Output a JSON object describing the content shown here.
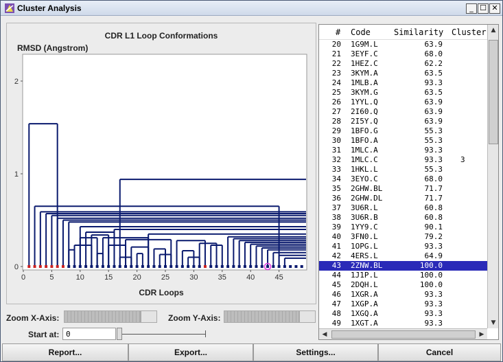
{
  "window": {
    "title": "Cluster Analysis",
    "minimize": "_",
    "maximize": "☐",
    "close": "✕"
  },
  "chart_data": {
    "type": "dendrogram",
    "title": "CDR L1 Loop Conformations",
    "xlabel": "CDR Loops",
    "ylabel": "RMSD (Angstrom)",
    "xticks": [
      "0",
      "5",
      "10",
      "15",
      "20",
      "25",
      "30",
      "35",
      "40",
      "45"
    ],
    "yticks": [
      "0",
      "1",
      "2"
    ],
    "ylim": [
      0,
      2.2
    ],
    "xlim": [
      0,
      50
    ],
    "line_color": "#0a1a6e",
    "leaf_color_default": "#0a1a6e",
    "leaf_color_highlight": "#cc2222",
    "selected_leaf": 43,
    "merges": [
      {
        "from": [
          1,
          6
        ],
        "height": 1.54
      },
      {
        "from": [
          17,
          50
        ],
        "height": 0.94
      },
      {
        "from": [
          2,
          45
        ],
        "height": 0.65
      },
      {
        "from": [
          3,
          50
        ],
        "height": 0.59
      },
      {
        "from": [
          4,
          50
        ],
        "height": 0.57
      },
      {
        "from": [
          5,
          50
        ],
        "height": 0.55
      },
      {
        "from": [
          6,
          50
        ],
        "height": 0.52
      },
      {
        "from": [
          7,
          50
        ],
        "height": 0.5
      },
      {
        "from": [
          8,
          50
        ],
        "height": 0.48
      },
      {
        "from": [
          10,
          50
        ],
        "height": 0.43
      },
      {
        "from": [
          11,
          16
        ],
        "height": 0.37
      },
      {
        "from": [
          16,
          50
        ],
        "height": 0.4
      },
      {
        "from": [
          10,
          13
        ],
        "height": 0.31
      },
      {
        "from": [
          12,
          15
        ],
        "height": 0.34
      },
      {
        "from": [
          14,
          22
        ],
        "height": 0.31
      },
      {
        "from": [
          22,
          50
        ],
        "height": 0.35
      },
      {
        "from": [
          9,
          12
        ],
        "height": 0.23
      },
      {
        "from": [
          15,
          18
        ],
        "height": 0.23
      },
      {
        "from": [
          18,
          26
        ],
        "height": 0.29
      },
      {
        "from": [
          27,
          32
        ],
        "height": 0.28
      },
      {
        "from": [
          31,
          34
        ],
        "height": 0.25
      },
      {
        "from": [
          36,
          50
        ],
        "height": 0.32
      },
      {
        "from": [
          37,
          50
        ],
        "height": 0.3
      },
      {
        "from": [
          38,
          50
        ],
        "height": 0.28
      },
      {
        "from": [
          39,
          50
        ],
        "height": 0.26
      },
      {
        "from": [
          40,
          50
        ],
        "height": 0.24
      },
      {
        "from": [
          41,
          50
        ],
        "height": 0.22
      },
      {
        "from": [
          42,
          50
        ],
        "height": 0.2
      },
      {
        "from": [
          43,
          50
        ],
        "height": 0.18
      },
      {
        "from": [
          44,
          50
        ],
        "height": 0.15
      },
      {
        "from": [
          45,
          50
        ],
        "height": 0.12
      },
      {
        "from": [
          46,
          50
        ],
        "height": 0.09
      },
      {
        "from": [
          33,
          35
        ],
        "height": 0.23
      },
      {
        "from": [
          19,
          22
        ],
        "height": 0.21
      },
      {
        "from": [
          23,
          25
        ],
        "height": 0.19
      },
      {
        "from": [
          28,
          30
        ],
        "height": 0.17
      },
      {
        "from": [
          20,
          21
        ],
        "height": 0.14
      },
      {
        "from": [
          24,
          26
        ],
        "height": 0.13
      },
      {
        "from": [
          29,
          31
        ],
        "height": 0.1
      },
      {
        "from": [
          13,
          14
        ],
        "height": 0.14
      },
      {
        "from": [
          17,
          19
        ],
        "height": 0.1
      },
      {
        "from": [
          8,
          9
        ],
        "height": 0.18
      }
    ],
    "leaves": [
      {
        "x": 1,
        "c": "r"
      },
      {
        "x": 2,
        "c": "r"
      },
      {
        "x": 3,
        "c": "r"
      },
      {
        "x": 4,
        "c": "r"
      },
      {
        "x": 5,
        "c": "r"
      },
      {
        "x": 6,
        "c": "r"
      },
      {
        "x": 7,
        "c": "r"
      },
      {
        "x": 8,
        "c": "b"
      },
      {
        "x": 9,
        "c": "b"
      },
      {
        "x": 10,
        "c": "b"
      },
      {
        "x": 11,
        "c": "b"
      },
      {
        "x": 12,
        "c": "b"
      },
      {
        "x": 13,
        "c": "b"
      },
      {
        "x": 14,
        "c": "b"
      },
      {
        "x": 15,
        "c": "b"
      },
      {
        "x": 16,
        "c": "b"
      },
      {
        "x": 17,
        "c": "b"
      },
      {
        "x": 18,
        "c": "b"
      },
      {
        "x": 19,
        "c": "b"
      },
      {
        "x": 20,
        "c": "b"
      },
      {
        "x": 21,
        "c": "b"
      },
      {
        "x": 22,
        "c": "b"
      },
      {
        "x": 23,
        "c": "b"
      },
      {
        "x": 24,
        "c": "b"
      },
      {
        "x": 25,
        "c": "b"
      },
      {
        "x": 26,
        "c": "b"
      },
      {
        "x": 27,
        "c": "b"
      },
      {
        "x": 28,
        "c": "b"
      },
      {
        "x": 29,
        "c": "b"
      },
      {
        "x": 30,
        "c": "b"
      },
      {
        "x": 31,
        "c": "b"
      },
      {
        "x": 32,
        "c": "r"
      },
      {
        "x": 33,
        "c": "b"
      },
      {
        "x": 34,
        "c": "b"
      },
      {
        "x": 35,
        "c": "b"
      },
      {
        "x": 36,
        "c": "b"
      },
      {
        "x": 37,
        "c": "b"
      },
      {
        "x": 38,
        "c": "b"
      },
      {
        "x": 39,
        "c": "b"
      },
      {
        "x": 40,
        "c": "b"
      },
      {
        "x": 41,
        "c": "b"
      },
      {
        "x": 42,
        "c": "b"
      },
      {
        "x": 43,
        "c": "sel"
      },
      {
        "x": 44,
        "c": "b"
      },
      {
        "x": 45,
        "c": "b"
      },
      {
        "x": 46,
        "c": "b"
      },
      {
        "x": 47,
        "c": "b"
      },
      {
        "x": 48,
        "c": "b"
      },
      {
        "x": 49,
        "c": "b"
      }
    ]
  },
  "table": {
    "headers": {
      "num": "#",
      "code": "Code",
      "similarity": "Similarity",
      "cluster": "Cluster"
    },
    "selected_index": 43,
    "rows": [
      {
        "n": "20",
        "code": "1G9M.L",
        "sim": "63.9",
        "cl": ""
      },
      {
        "n": "21",
        "code": "3EYF.C",
        "sim": "68.0",
        "cl": ""
      },
      {
        "n": "22",
        "code": "1HEZ.C",
        "sim": "62.2",
        "cl": ""
      },
      {
        "n": "23",
        "code": "3KYM.A",
        "sim": "63.5",
        "cl": ""
      },
      {
        "n": "24",
        "code": "1MLB.A",
        "sim": "93.3",
        "cl": ""
      },
      {
        "n": "25",
        "code": "3KYM.G",
        "sim": "63.5",
        "cl": ""
      },
      {
        "n": "26",
        "code": "1YYL.Q",
        "sim": "63.9",
        "cl": ""
      },
      {
        "n": "27",
        "code": "2I60.Q",
        "sim": "63.9",
        "cl": ""
      },
      {
        "n": "28",
        "code": "2I5Y.Q",
        "sim": "63.9",
        "cl": ""
      },
      {
        "n": "29",
        "code": "1BFO.G",
        "sim": "55.3",
        "cl": ""
      },
      {
        "n": "30",
        "code": "1BFO.A",
        "sim": "55.3",
        "cl": ""
      },
      {
        "n": "31",
        "code": "1MLC.A",
        "sim": "93.3",
        "cl": ""
      },
      {
        "n": "32",
        "code": "1MLC.C",
        "sim": "93.3",
        "cl": "3"
      },
      {
        "n": "33",
        "code": "1HKL.L",
        "sim": "55.3",
        "cl": ""
      },
      {
        "n": "34",
        "code": "3EYO.C",
        "sim": "68.0",
        "cl": ""
      },
      {
        "n": "35",
        "code": "2GHW.BL",
        "sim": "71.7",
        "cl": ""
      },
      {
        "n": "36",
        "code": "2GHW.DL",
        "sim": "71.7",
        "cl": ""
      },
      {
        "n": "37",
        "code": "3U6R.L",
        "sim": "60.8",
        "cl": ""
      },
      {
        "n": "38",
        "code": "3U6R.B",
        "sim": "60.8",
        "cl": ""
      },
      {
        "n": "39",
        "code": "1YY9.C",
        "sim": "90.1",
        "cl": ""
      },
      {
        "n": "40",
        "code": "3FN0.L",
        "sim": "79.2",
        "cl": ""
      },
      {
        "n": "41",
        "code": "1OPG.L",
        "sim": "93.3",
        "cl": ""
      },
      {
        "n": "42",
        "code": "4ERS.L",
        "sim": "64.9",
        "cl": ""
      },
      {
        "n": "43",
        "code": "2ZNW.BL",
        "sim": "100.0",
        "cl": ""
      },
      {
        "n": "44",
        "code": "1J1P.L",
        "sim": "100.0",
        "cl": ""
      },
      {
        "n": "45",
        "code": "2DQH.L",
        "sim": "100.0",
        "cl": ""
      },
      {
        "n": "46",
        "code": "1XGR.A",
        "sim": "93.3",
        "cl": ""
      },
      {
        "n": "47",
        "code": "1XGP.A",
        "sim": "93.3",
        "cl": ""
      },
      {
        "n": "48",
        "code": "1XGQ.A",
        "sim": "93.3",
        "cl": ""
      },
      {
        "n": "49",
        "code": "1XGT.A",
        "sim": "93.3",
        "cl": ""
      }
    ]
  },
  "controls": {
    "zoom_x_label": "Zoom X-Axis:",
    "zoom_y_label": "Zoom Y-Axis:",
    "start_label": "Start at:",
    "start_value": "0"
  },
  "buttons": {
    "report": "Report...",
    "export": "Export...",
    "settings": "Settings...",
    "cancel": "Cancel"
  }
}
